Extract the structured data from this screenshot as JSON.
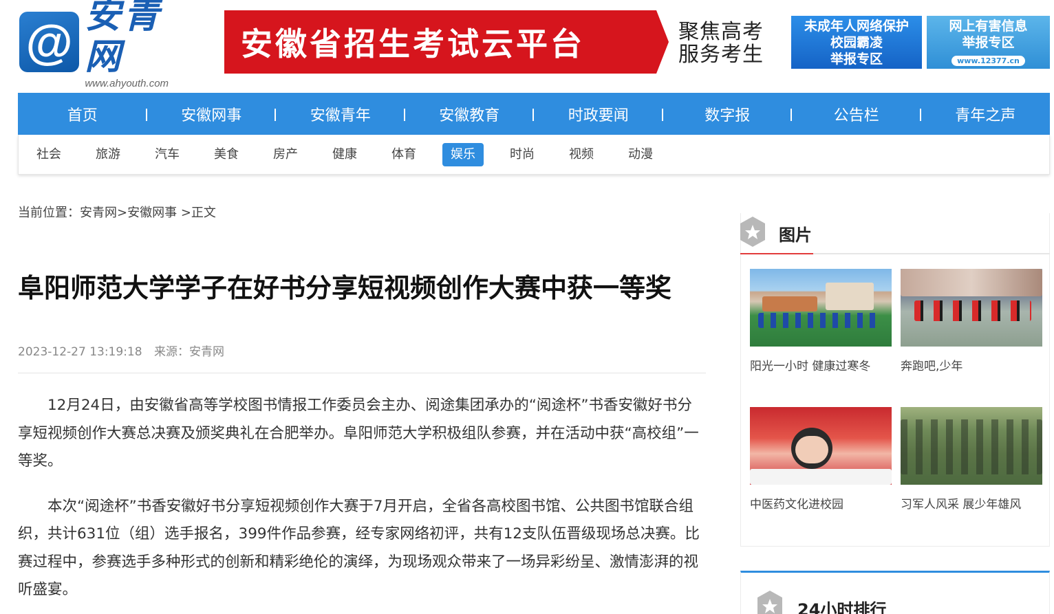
{
  "header": {
    "logo_mark": "@",
    "logo_name": "安青网",
    "logo_url": "www.ahyouth.com",
    "exam_banner": "安徽省招生考试云平台",
    "slogan_line1": "聚焦高考",
    "slogan_line2": "服务考生",
    "protect_banner_line1": "未成年人网络保护",
    "protect_banner_line2": "校园霸凌",
    "protect_banner_line3": "举报专区",
    "report_banner_line1": "网上有害信息",
    "report_banner_line2": "举报专区",
    "report_banner_url": "www.12377.cn"
  },
  "main_nav": [
    {
      "label": "首页"
    },
    {
      "label": "安徽网事"
    },
    {
      "label": "安徽青年"
    },
    {
      "label": "安徽教育"
    },
    {
      "label": "时政要闻"
    },
    {
      "label": "数字报"
    },
    {
      "label": "公告栏"
    },
    {
      "label": "青年之声"
    }
  ],
  "sub_nav": [
    {
      "label": "社会"
    },
    {
      "label": "旅游"
    },
    {
      "label": "汽车"
    },
    {
      "label": "美食"
    },
    {
      "label": "房产"
    },
    {
      "label": "健康"
    },
    {
      "label": "体育"
    },
    {
      "label": "娱乐",
      "active": true
    },
    {
      "label": "时尚"
    },
    {
      "label": "视频"
    },
    {
      "label": "动漫"
    }
  ],
  "breadcrumb": {
    "prefix": "当前位置：",
    "home": "安青网",
    "sep1": ">",
    "section": "安徽网事",
    "sep2": " >",
    "current": "正文"
  },
  "article": {
    "title": "阜阳师范大学学子在好书分享短视频创作大赛中获一等奖",
    "datetime": "2023-12-27 13:19:18",
    "source_label": "来源：",
    "source": "安青网",
    "paragraphs": [
      "12月24日，由安徽省高等学校图书情报工作委员会主办、阅途集团承办的“阅途杯”书香安徽好书分享短视频创作大赛总决赛及颁奖典礼在合肥举办。阜阳师范大学积极组队参赛，并在活动中获“高校组”一等奖。",
      "本次“阅途杯”书香安徽好书分享短视频创作大赛于7月开启，全省各高校图书馆、公共图书馆联合组织，共计631位（组）选手报名，399件作品参赛，经专家网络初评，共有12支队伍晋级现场总决赛。比赛过程中，参赛选手多种形式的创新和精彩绝伦的演绎，为现场观众带来了一场异彩纷呈、激情澎湃的视听盛宴。"
    ]
  },
  "sidebar": {
    "pictures_title": "图片",
    "pictures": [
      {
        "caption": "阳光一小时 健康过寒冬"
      },
      {
        "caption": "奔跑吧,少年"
      },
      {
        "caption": "中医药文化进校园"
      },
      {
        "caption": "习军人风采 展少年雄风"
      }
    ],
    "ranking_title": "24小时排行"
  },
  "colors": {
    "nav_blue": "#2f8ddf",
    "exam_red": "#d6151d",
    "accent_red": "#e23b3b"
  }
}
